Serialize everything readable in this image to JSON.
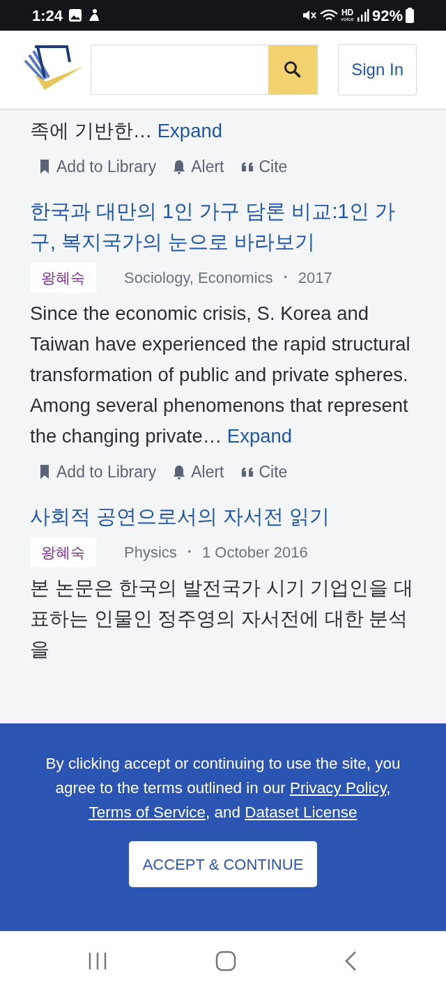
{
  "status_bar": {
    "time": "1:24",
    "hd": "HD",
    "voice": "voice",
    "battery": "92%"
  },
  "header": {
    "sign_in": "Sign In"
  },
  "papers": [
    {
      "abstract": "족에 기반한…",
      "expand": "Expand",
      "actions": [
        "Add to Library",
        "Alert",
        "Cite"
      ]
    },
    {
      "title": "한국과 대만의 1인 가구 담론 비교:1인 가구, 복지국가의 눈으로 바라보기",
      "authors": [
        "왕혜숙"
      ],
      "fields": "Sociology, Economics",
      "separator": "•",
      "date": "2017",
      "abstract": "Since the economic crisis, S. Korea and Taiwan have experienced the rapid structural transformation of public and private spheres. Among several phenomenons that represent the changing private…",
      "expand": "Expand",
      "actions": [
        "Add to Library",
        "Alert",
        "Cite"
      ]
    },
    {
      "title": "사회적 공연으로서의 자서전 읽기",
      "authors": [
        "왕혜숙"
      ],
      "fields": "Physics",
      "separator": "•",
      "date": "1 October 2016",
      "abstract": "본 논문은 한국의 발전국가 시기 기업인을 대표하는 인물인 정주영의 자서전에 대한 분석을"
    }
  ],
  "cookie_banner": {
    "parts": [
      {
        "text": "By clicking accept or continuing to use the site, you agree to the terms outlined in our ",
        "link": false
      },
      {
        "text": "Privacy Policy",
        "link": true
      },
      {
        "text": ", ",
        "link": false
      },
      {
        "text": "Terms of Service",
        "link": true
      },
      {
        "text": ", and ",
        "link": false
      },
      {
        "text": "Dataset License",
        "link": true
      }
    ],
    "button": "ACCEPT & CONTINUE"
  }
}
